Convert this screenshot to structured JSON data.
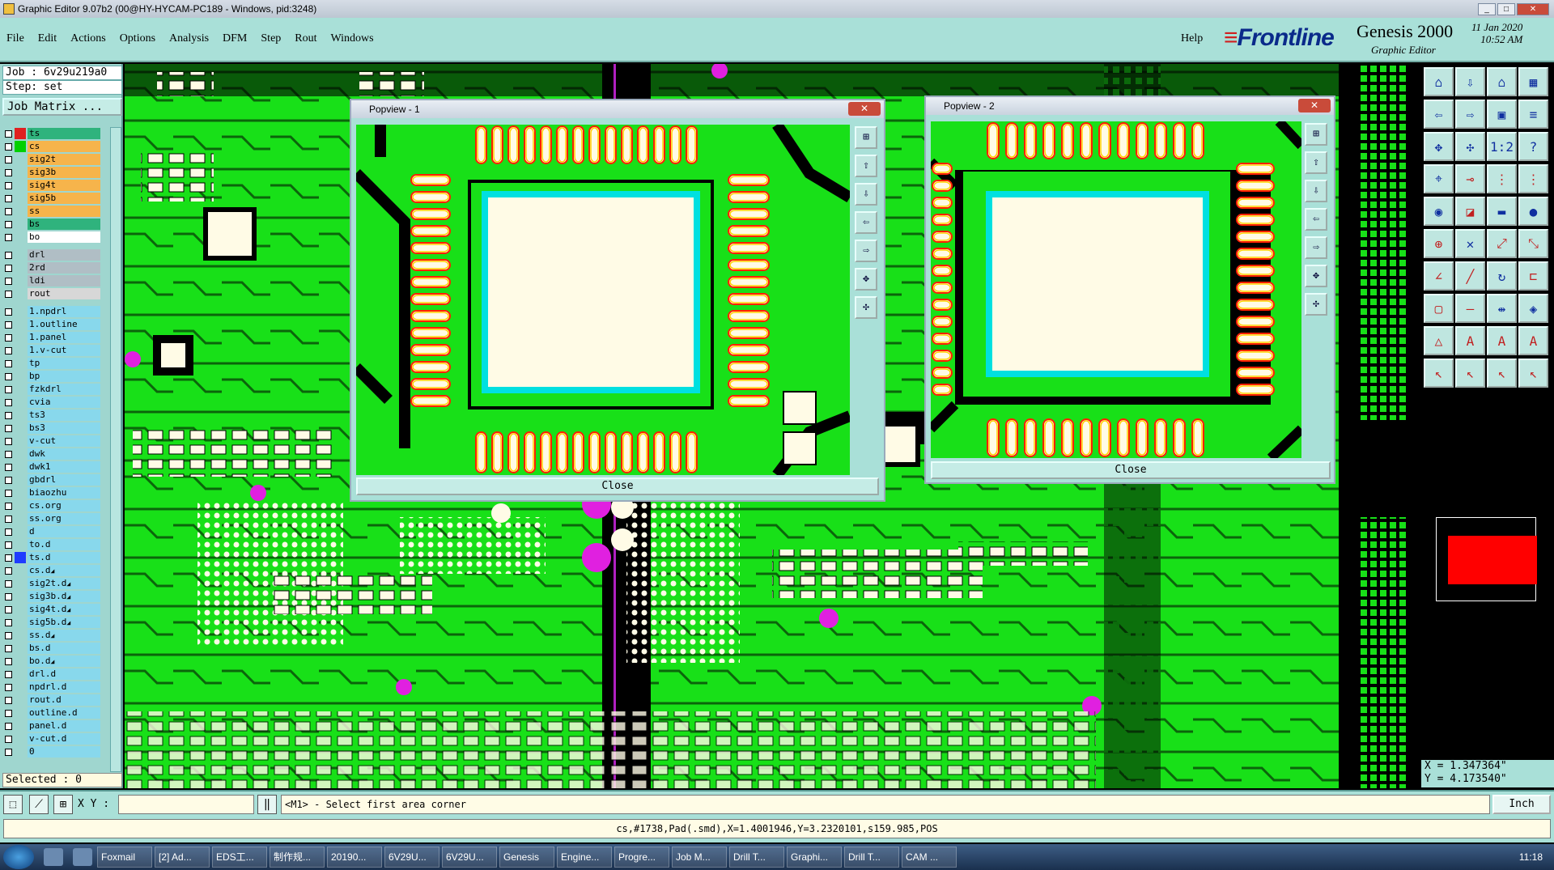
{
  "window": {
    "title": "Graphic Editor 9.07b2 (00@HY-HYCAM-PC189 - Windows, pid:3248)"
  },
  "menu": {
    "items": [
      "File",
      "Edit",
      "Actions",
      "Options",
      "Analysis",
      "DFM",
      "Step",
      "Rout",
      "Windows"
    ],
    "help": "Help"
  },
  "brand": {
    "logo": "Frontline",
    "product": "Genesis 2000",
    "subtitle": "Graphic Editor",
    "date": "11 Jan 2020",
    "time": "10:52 AM"
  },
  "job": {
    "job_line": "Job : 6v29u219a0",
    "step_line": "Step: set",
    "matrix_button": "Job Matrix ..."
  },
  "layers": [
    {
      "name": "ts",
      "color": "#e02020",
      "bg": "#2fb37d"
    },
    {
      "name": "cs",
      "color": "#00d000",
      "bg": "#f6b44b"
    },
    {
      "name": "sig2t",
      "color": "",
      "bg": "#f6b44b"
    },
    {
      "name": "sig3b",
      "color": "",
      "bg": "#f6b44b"
    },
    {
      "name": "sig4t",
      "color": "",
      "bg": "#f6b44b"
    },
    {
      "name": "sig5b",
      "color": "",
      "bg": "#f6b44b"
    },
    {
      "name": "ss",
      "color": "",
      "bg": "#f6b44b"
    },
    {
      "name": "bs",
      "color": "",
      "bg": "#2fb37d"
    },
    {
      "name": "bo",
      "color": "",
      "bg": "#ffffff"
    },
    {
      "name": "drl",
      "color": "",
      "bg": "#b0bec5",
      "gap": true
    },
    {
      "name": "2rd",
      "color": "",
      "bg": "#b0bec5"
    },
    {
      "name": "ldi",
      "color": "",
      "bg": "#b0bec5"
    },
    {
      "name": "rout",
      "color": "",
      "bg": "#d7d7d7"
    },
    {
      "name": "1.npdrl",
      "color": "",
      "bg": "#88d8ec",
      "gap": true
    },
    {
      "name": "1.outline",
      "color": "",
      "bg": "#88d8ec"
    },
    {
      "name": "1.panel",
      "color": "",
      "bg": "#88d8ec"
    },
    {
      "name": "1.v-cut",
      "color": "",
      "bg": "#88d8ec"
    },
    {
      "name": "tp",
      "color": "",
      "bg": "#88d8ec"
    },
    {
      "name": "bp",
      "color": "",
      "bg": "#88d8ec"
    },
    {
      "name": "fzkdrl",
      "color": "",
      "bg": "#88d8ec"
    },
    {
      "name": "cvia",
      "color": "",
      "bg": "#88d8ec"
    },
    {
      "name": "ts3",
      "color": "",
      "bg": "#88d8ec"
    },
    {
      "name": "bs3",
      "color": "",
      "bg": "#88d8ec"
    },
    {
      "name": "v-cut",
      "color": "",
      "bg": "#88d8ec"
    },
    {
      "name": "dwk",
      "color": "",
      "bg": "#88d8ec"
    },
    {
      "name": "dwk1",
      "color": "",
      "bg": "#88d8ec"
    },
    {
      "name": "gbdrl",
      "color": "",
      "bg": "#88d8ec"
    },
    {
      "name": "biaozhu",
      "color": "",
      "bg": "#88d8ec"
    },
    {
      "name": "cs.org",
      "color": "",
      "bg": "#88d8ec"
    },
    {
      "name": "ss.org",
      "color": "",
      "bg": "#88d8ec"
    },
    {
      "name": "d",
      "color": "",
      "bg": "#88d8ec"
    },
    {
      "name": "to.d",
      "color": "",
      "bg": "#88d8ec"
    },
    {
      "name": "ts.d",
      "color": "#1f3cff",
      "bg": "#88d8ec"
    },
    {
      "name": "cs.d",
      "color": "",
      "bg": "#88d8ec",
      "arrow": true
    },
    {
      "name": "sig2t.d",
      "color": "",
      "bg": "#88d8ec",
      "arrow": true
    },
    {
      "name": "sig3b.d",
      "color": "",
      "bg": "#88d8ec",
      "arrow": true
    },
    {
      "name": "sig4t.d",
      "color": "",
      "bg": "#88d8ec",
      "arrow": true
    },
    {
      "name": "sig5b.d",
      "color": "",
      "bg": "#88d8ec",
      "arrow": true
    },
    {
      "name": "ss.d",
      "color": "",
      "bg": "#88d8ec",
      "arrow": true
    },
    {
      "name": "bs.d",
      "color": "",
      "bg": "#88d8ec"
    },
    {
      "name": "bo.d",
      "color": "",
      "bg": "#88d8ec",
      "arrow": true
    },
    {
      "name": "drl.d",
      "color": "",
      "bg": "#88d8ec"
    },
    {
      "name": "npdrl.d",
      "color": "",
      "bg": "#88d8ec"
    },
    {
      "name": "rout.d",
      "color": "",
      "bg": "#88d8ec"
    },
    {
      "name": "outline.d",
      "color": "",
      "bg": "#88d8ec"
    },
    {
      "name": "panel.d",
      "color": "",
      "bg": "#88d8ec"
    },
    {
      "name": "v-cut.d",
      "color": "",
      "bg": "#88d8ec"
    },
    {
      "name": "0",
      "color": "",
      "bg": "#88d8ec"
    }
  ],
  "selected": "Selected : 0",
  "popview1": {
    "title": "Popview - 1",
    "close": "Close"
  },
  "popview2": {
    "title": "Popview - 2",
    "close": "Close"
  },
  "coords": {
    "x": "X = 1.347364\"",
    "y": "Y = 4.173540\""
  },
  "status": {
    "xy_label": "X Y :",
    "prompt": "<M1> - Select first area corner",
    "unit": "Inch"
  },
  "info": "cs,#1738,Pad(.smd),X=1.4001946,Y=3.2320101,s159.985,POS",
  "taskbar": {
    "items": [
      "Foxmail",
      "[2] Ad...",
      "EDS工...",
      "制作规...",
      "20190...",
      "6V29U...",
      "6V29U...",
      "Genesis",
      "Engine...",
      "Progre...",
      "Job M...",
      "Drill T...",
      "Graphi...",
      "Drill T...",
      "CAM ..."
    ],
    "clock": "11:18"
  },
  "colors": {
    "board": "#18e018",
    "menu": "#a9e0d8",
    "copper": "#fffbe6",
    "pad_edge": "#ff2000",
    "pad_inner": "#ffd200",
    "via": "#e020e0",
    "cyan": "#00e0e0"
  }
}
